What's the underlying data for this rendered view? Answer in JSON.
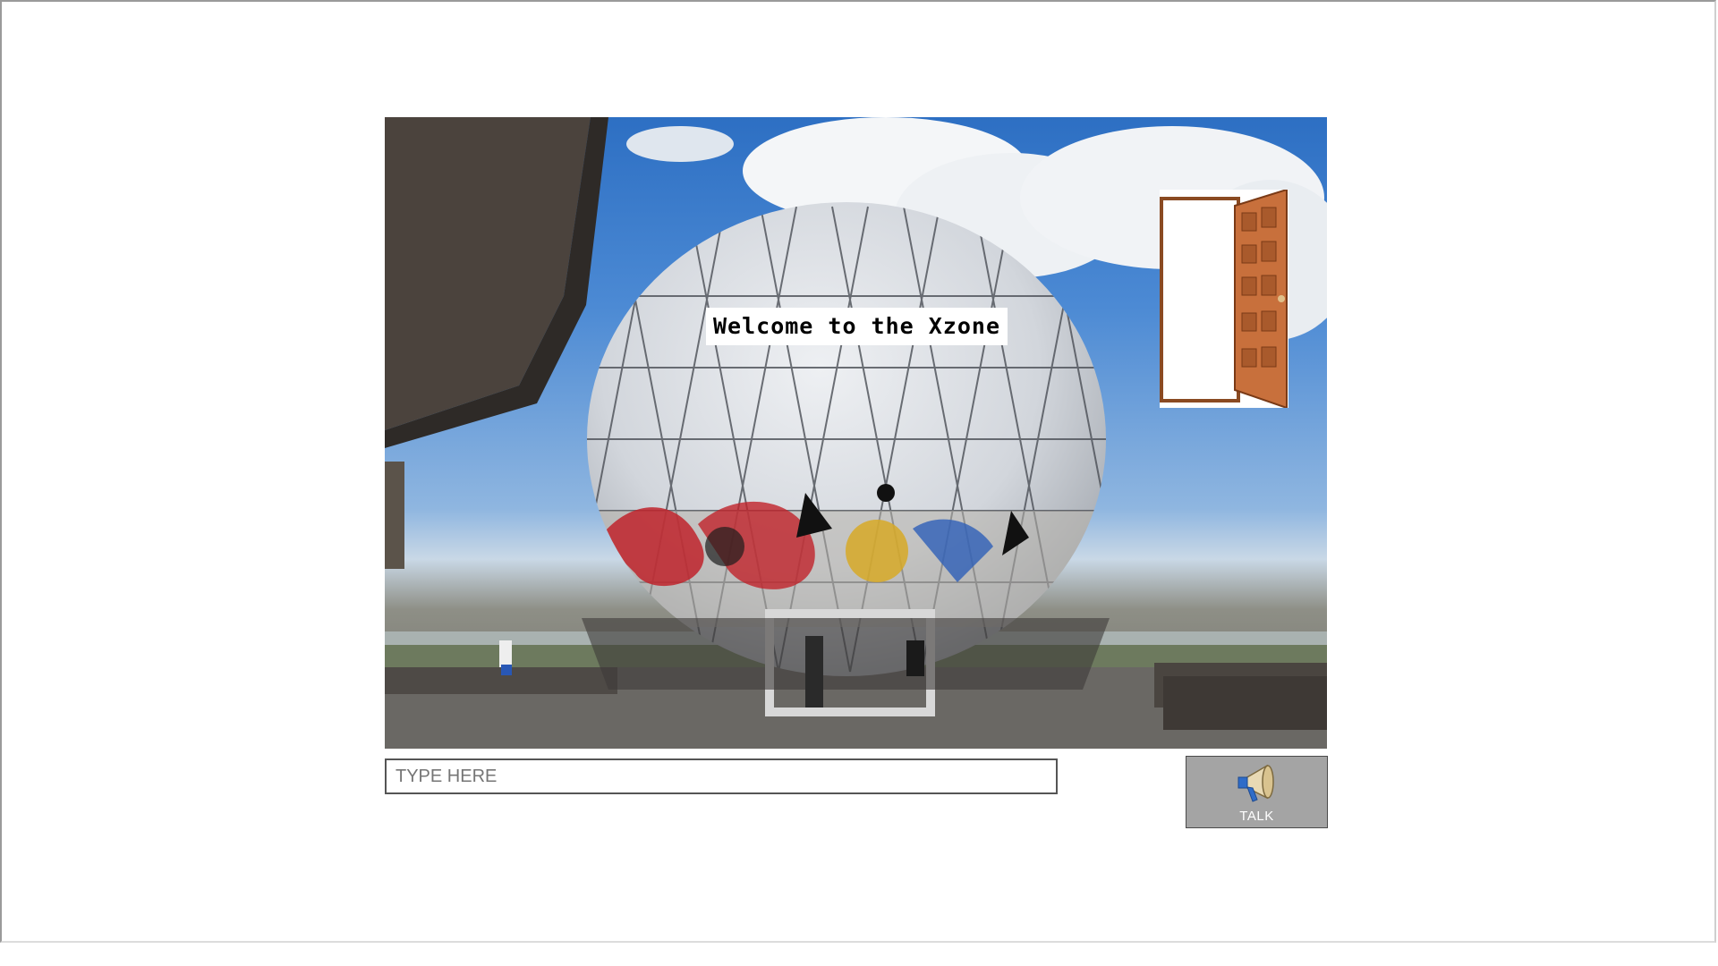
{
  "scene": {
    "welcome_text": "Welcome to the Xzone",
    "sky_color": "#4c8ad4",
    "dome_color": "#d9dde3"
  },
  "door": {
    "icon": "open-door-icon",
    "door_color": "#c8703c"
  },
  "chat": {
    "placeholder": "TYPE HERE",
    "value": ""
  },
  "talk_button": {
    "label": "TALK",
    "icon": "megaphone-icon",
    "background": "#a4a4a4"
  }
}
